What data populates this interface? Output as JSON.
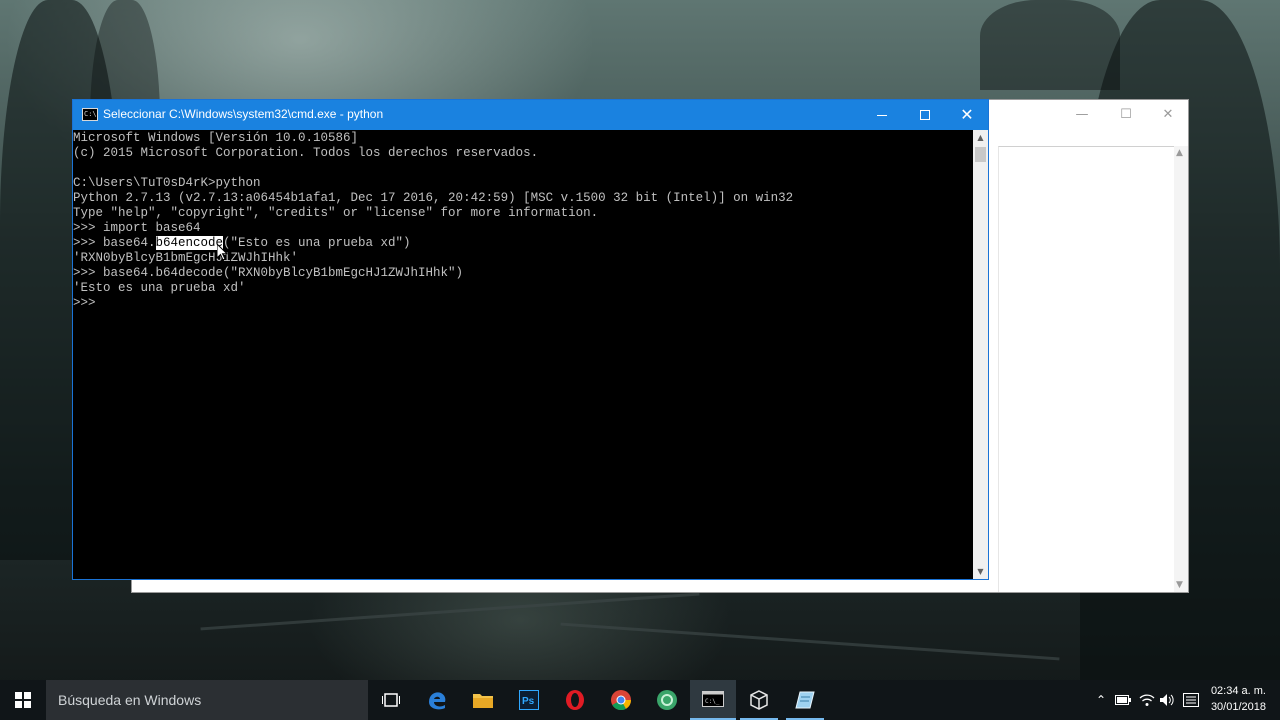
{
  "cmd_window": {
    "title": "Seleccionar C:\\Windows\\system32\\cmd.exe - python",
    "icon": "cmd-icon",
    "controls": [
      "minimize",
      "maximize",
      "close"
    ],
    "console_lines": [
      "Microsoft Windows [Versión 10.0.10586]",
      "(c) 2015 Microsoft Corporation. Todos los derechos reservados.",
      "",
      "C:\\Users\\TuT0sD4rK>python",
      "Python 2.7.13 (v2.7.13:a06454b1afa1, Dec 17 2016, 20:42:59) [MSC v.1500 32 bit (Intel)] on win32",
      "Type \"help\", \"copyright\", \"credits\" or \"license\" for more information.",
      ">>> import base64",
      "",
      "'RXN0byBlcyB1bmEgcHJ1ZWJhIHhk'",
      ">>> base64.b64decode(\"RXN0byBlcyB1bmEgcHJ1ZWJhIHhk\")",
      "'Esto es una prueba xd'",
      ">>> "
    ],
    "selection_line": {
      "before": ">>> base64.",
      "selected": "b64encode",
      "after": "(\"Esto es una prueba xd\")"
    }
  },
  "taskbar": {
    "search_placeholder": "Búsqueda en Windows",
    "apps": [
      "task-view",
      "edge",
      "file-explorer",
      "photoshop",
      "opera",
      "chrome",
      "app-green",
      "cmd",
      "virtualbox",
      "notepad"
    ],
    "active_app": "cmd",
    "clock_time": "02:34 a. m.",
    "clock_date": "30/01/2018"
  },
  "colors": {
    "titlebar": "#1a82e0",
    "console_bg": "#000000",
    "console_fg": "#c0c0c0",
    "taskbar": "#101518"
  }
}
